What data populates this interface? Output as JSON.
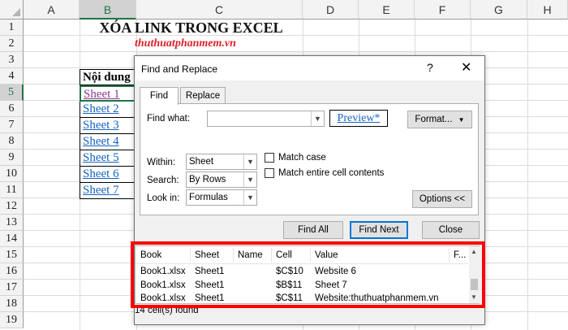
{
  "columns": [
    "A",
    "B",
    "C",
    "D",
    "E",
    "F",
    "G",
    "H"
  ],
  "rows": [
    "1",
    "2",
    "3",
    "4",
    "5",
    "6",
    "7",
    "8",
    "9",
    "10",
    "11",
    "12",
    "13",
    "14",
    "15",
    "16",
    "17",
    "18",
    "19"
  ],
  "sheet": {
    "title": "XÓA LINK TRONG EXCEL",
    "watermark": "thuthuatphanmem.vn",
    "header_cell": "Nội dung",
    "cells": [
      "Sheet 1",
      "Sheet 2",
      "Sheet 3",
      "Sheet 4",
      "Sheet 5",
      "Sheet 6",
      "Sheet 7"
    ]
  },
  "dialog": {
    "title": "Find and Replace",
    "help": "?",
    "close": "✕",
    "tabs": [
      "Find",
      "Replace"
    ],
    "find_what_label": "Find what:",
    "find_what_value": "",
    "preview": "Preview*",
    "format_button": "Format...",
    "within_label": "Within:",
    "within_value": "Sheet",
    "search_label": "Search:",
    "search_value": "By Rows",
    "lookin_label": "Look in:",
    "lookin_value": "Formulas",
    "match_case": "Match case",
    "match_entire": "Match entire cell contents",
    "options_button": "Options <<",
    "find_all": "Find All",
    "find_next": "Find Next",
    "close_button": "Close"
  },
  "results": {
    "headers": [
      "Book",
      "Sheet",
      "Name",
      "Cell",
      "Value",
      "F..."
    ],
    "rows": [
      {
        "book": "Book1.xlsx",
        "sheet": "Sheet1",
        "name": "",
        "cell": "$C$10",
        "value": "Website 6"
      },
      {
        "book": "Book1.xlsx",
        "sheet": "Sheet1",
        "name": "",
        "cell": "$B$11",
        "value": "Sheet 7"
      },
      {
        "book": "Book1.xlsx",
        "sheet": "Sheet1",
        "name": "",
        "cell": "$C$11",
        "value": "Website:thuthuatphanmem.vn"
      }
    ],
    "status": "14 cell(s) found"
  },
  "colors": {
    "accent": "#217346",
    "highlight_box": "#ff0000",
    "link": "#1565c0",
    "visited_link": "#8a3b8f"
  }
}
